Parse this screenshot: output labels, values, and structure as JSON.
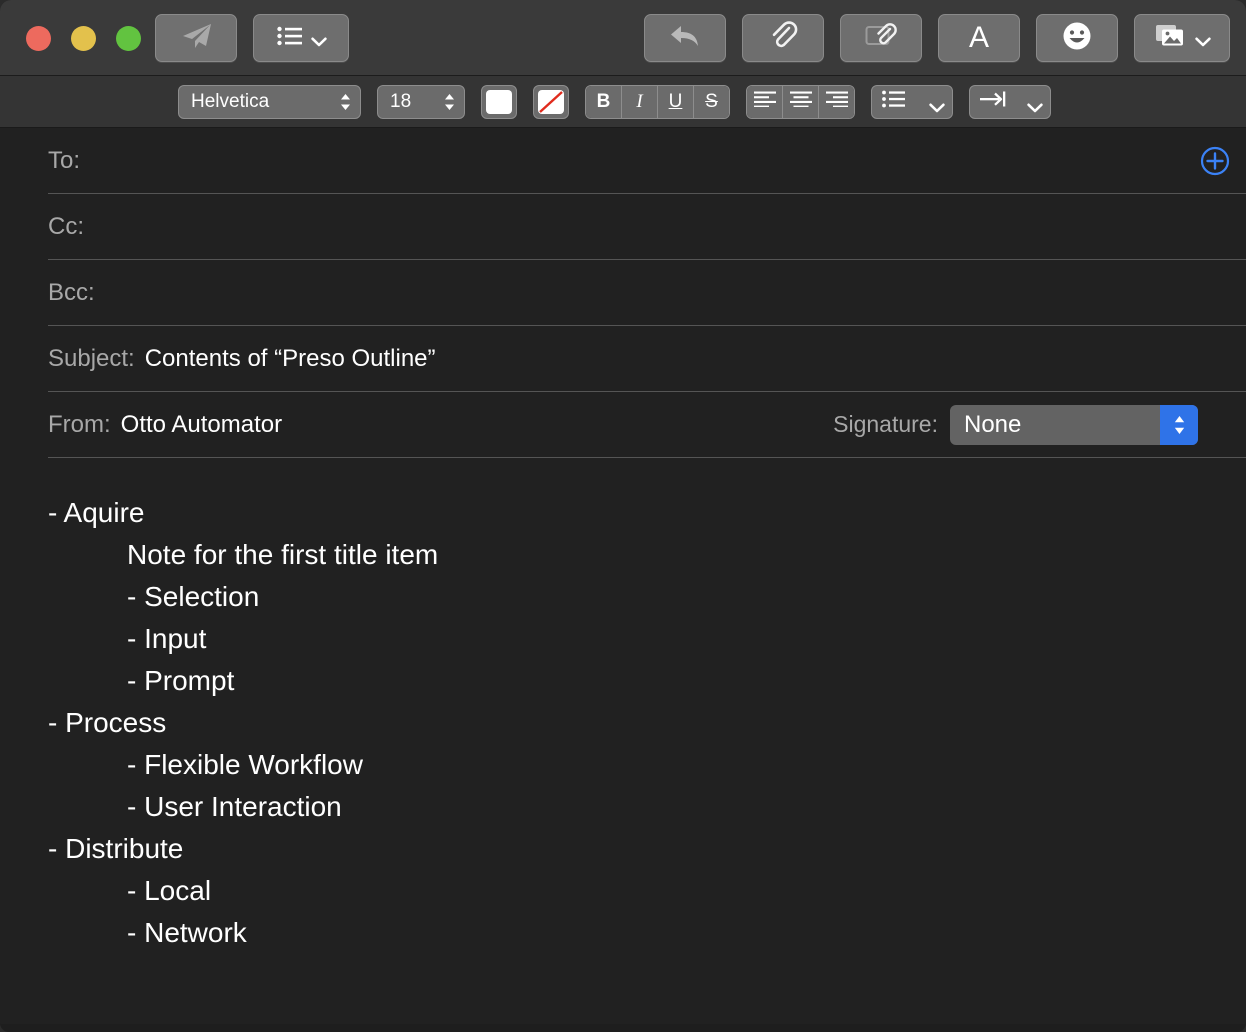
{
  "window": {
    "traffic_lights": [
      {
        "name": "close",
        "color": "#ed6a5e"
      },
      {
        "name": "minimize",
        "color": "#e3c14c"
      },
      {
        "name": "maximize",
        "color": "#62c340"
      }
    ]
  },
  "toolbar": {
    "left": [
      {
        "name": "send-button",
        "icon": "paper-plane-icon",
        "label": ""
      },
      {
        "name": "header-fields-button",
        "icon": "list-icon",
        "label": "",
        "has_chevron": true
      }
    ],
    "right": [
      {
        "name": "reply-button",
        "icon": "reply-arrow-icon",
        "label": ""
      },
      {
        "name": "attach-button",
        "icon": "paperclip-icon",
        "label": ""
      },
      {
        "name": "markup-attach-button",
        "icon": "attach-document-icon",
        "label": ""
      },
      {
        "name": "format-button",
        "icon": "letter-a-icon",
        "label": "A"
      },
      {
        "name": "emoji-button",
        "icon": "smiley-face-icon",
        "label": ""
      },
      {
        "name": "media-browser-button",
        "icon": "photos-icon",
        "label": "",
        "has_chevron": true
      }
    ]
  },
  "format_bar": {
    "font_family": "Helvetica",
    "font_size": "18",
    "text_color_swatch": "#ffffff",
    "no_color_swatch_line": "#e02b1d",
    "style_buttons": [
      {
        "name": "bold-button",
        "label": "B"
      },
      {
        "name": "italic-button",
        "label": "I"
      },
      {
        "name": "underline-button",
        "label": "U"
      },
      {
        "name": "strikethrough-button",
        "label": "S"
      }
    ],
    "align_buttons": [
      {
        "name": "align-left-button",
        "icon": "align-left-icon"
      },
      {
        "name": "align-center-button",
        "icon": "align-center-icon"
      },
      {
        "name": "align-right-button",
        "icon": "align-right-icon"
      }
    ],
    "list_button": {
      "name": "bullet-list-button",
      "icon": "bullet-list-icon"
    },
    "indent_button": {
      "name": "indent-button",
      "icon": "indent-arrow-icon"
    }
  },
  "headers": {
    "to": {
      "label": "To:",
      "value": "",
      "placeholder": ""
    },
    "cc": {
      "label": "Cc:",
      "value": "",
      "placeholder": ""
    },
    "bcc": {
      "label": "Bcc:",
      "value": "",
      "placeholder": ""
    },
    "subject": {
      "label": "Subject:",
      "value": "Contents of “Preso Outline”",
      "placeholder": ""
    },
    "from": {
      "label": "From:",
      "value": "Otto Automator"
    },
    "signature": {
      "label": "Signature:",
      "value": "None",
      "accent": "#2f73e8"
    },
    "add_recipient": {
      "name": "add-recipient-button",
      "icon": "plus-circle-icon",
      "accent": "#3b82f6"
    }
  },
  "message_body": {
    "lines": [
      {
        "text": "- Aquire",
        "indent": 0
      },
      {
        "text": "Note for the first title item",
        "indent": 1
      },
      {
        "text": "- Selection",
        "indent": 1
      },
      {
        "text": "- Input",
        "indent": 1
      },
      {
        "text": "- Prompt",
        "indent": 1
      },
      {
        "text": "- Process",
        "indent": 0
      },
      {
        "text": "- Flexible Workflow",
        "indent": 1
      },
      {
        "text": "- User Interaction",
        "indent": 1
      },
      {
        "text": "- Distribute",
        "indent": 0
      },
      {
        "text": "- Local",
        "indent": 1
      },
      {
        "text": "- Network",
        "indent": 1
      }
    ]
  }
}
